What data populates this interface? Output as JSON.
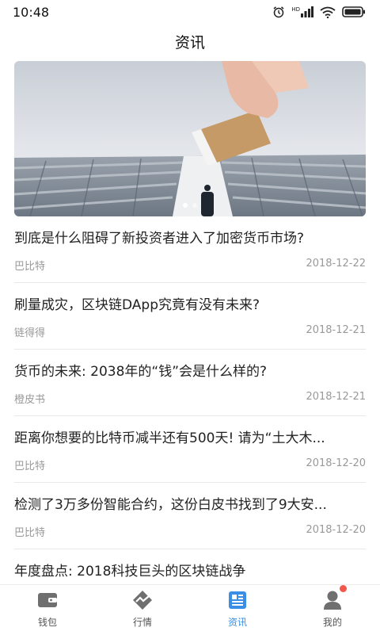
{
  "status_bar": {
    "time": "10:48",
    "network_label": "HD"
  },
  "header": {
    "title": "资讯"
  },
  "banner": {
    "dot_count": 2,
    "active_dot": 1
  },
  "news": [
    {
      "title": "到底是什么阻碍了新投资者进入了加密货币市场?",
      "source": "巴比特",
      "date": "2018-12-22"
    },
    {
      "title": "刷量成灾，区块链DApp究竟有没有未来?",
      "source": "链得得",
      "date": "2018-12-21"
    },
    {
      "title": "货币的未来: 2038年的“钱”会是什么样的?",
      "source": "橙皮书",
      "date": "2018-12-21"
    },
    {
      "title": "距离你想要的比特币减半还有500天! 请为“土大木...",
      "source": "巴比特",
      "date": "2018-12-20"
    },
    {
      "title": "检测了3万多份智能合约，这份白皮书找到了9大安...",
      "source": "巴比特",
      "date": "2018-12-20"
    },
    {
      "title": "年度盘点: 2018科技巨头的区块链战争",
      "source": "",
      "date": ""
    }
  ],
  "tabbar": {
    "tabs": [
      {
        "label": "钱包",
        "icon": "wallet-icon"
      },
      {
        "label": "行情",
        "icon": "market-icon"
      },
      {
        "label": "资讯",
        "icon": "news-icon"
      },
      {
        "label": "我的",
        "icon": "profile-icon"
      }
    ],
    "active_index": 2
  },
  "colors": {
    "accent": "#3a8ee6",
    "badge": "#f2574b",
    "muted_text": "#999999"
  }
}
